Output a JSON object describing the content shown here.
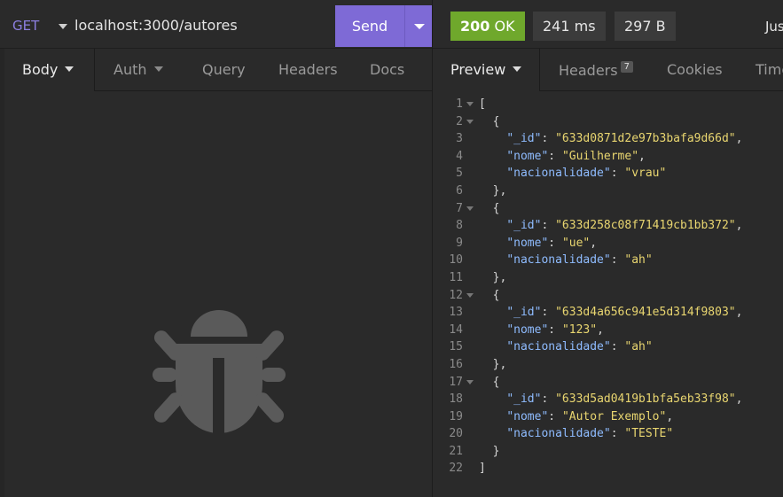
{
  "request": {
    "method": "GET",
    "url": "localhost:3000/autores",
    "send_label": "Send"
  },
  "response": {
    "status_code": "200",
    "status_text": "OK",
    "time": "241 ms",
    "size": "297 B",
    "truncated_tab": "Jus"
  },
  "left_tabs": {
    "body": "Body",
    "auth": "Auth",
    "query": "Query",
    "headers": "Headers",
    "docs": "Docs"
  },
  "right_tabs": {
    "preview": "Preview",
    "headers": "Headers",
    "headers_count": "7",
    "cookies": "Cookies",
    "timeline": "Time"
  },
  "colors": {
    "accent": "#7e6ad6",
    "status_ok": "#6fa82c",
    "json_key": "#8fbcff",
    "json_string": "#e9d670"
  },
  "icons": {
    "empty_body": "bug-icon"
  },
  "json_lines": [
    {
      "n": "1",
      "fold": true
    },
    {
      "n": "2",
      "fold": true
    },
    {
      "n": "3"
    },
    {
      "n": "4"
    },
    {
      "n": "5"
    },
    {
      "n": "6"
    },
    {
      "n": "7",
      "fold": true
    },
    {
      "n": "8"
    },
    {
      "n": "9"
    },
    {
      "n": "10"
    },
    {
      "n": "11"
    },
    {
      "n": "12",
      "fold": true
    },
    {
      "n": "13"
    },
    {
      "n": "14"
    },
    {
      "n": "15"
    },
    {
      "n": "16"
    },
    {
      "n": "17",
      "fold": true
    },
    {
      "n": "18"
    },
    {
      "n": "19"
    },
    {
      "n": "20"
    },
    {
      "n": "21"
    },
    {
      "n": "22"
    }
  ],
  "json_body": [
    {
      "_id": "633d0871d2e97b3bafa9d66d",
      "nome": "Guilherme",
      "nacionalidade": "vrau"
    },
    {
      "_id": "633d258c08f71419cb1bb372",
      "nome": "ue",
      "nacionalidade": "ah"
    },
    {
      "_id": "633d4a656c941e5d314f9803",
      "nome": "123",
      "nacionalidade": "ah"
    },
    {
      "_id": "633d5ad0419b1bfa5eb33f98",
      "nome": "Autor Exemplo",
      "nacionalidade": "TESTE"
    }
  ]
}
